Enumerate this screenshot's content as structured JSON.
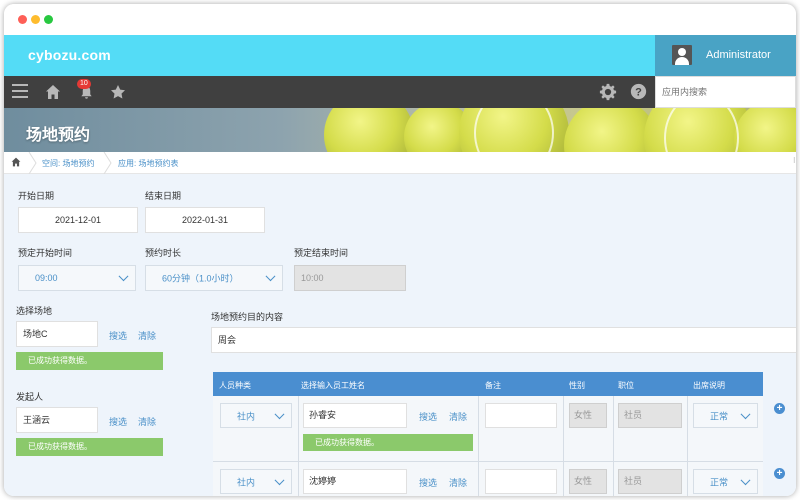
{
  "header": {
    "logo": "cybozu.com",
    "user": "Administrator"
  },
  "nav": {
    "notification_count": "10",
    "search_placeholder": "应用内搜索"
  },
  "banner": {
    "title": "场地预约"
  },
  "breadcrumb": {
    "space": "空间: 场地预约",
    "app": "应用: 场地预约表"
  },
  "form": {
    "start_date": {
      "label": "开始日期",
      "value": "2021-12-01"
    },
    "end_date": {
      "label": "结束日期",
      "value": "2022-01-31"
    },
    "start_time": {
      "label": "预定开始时间",
      "value": "09:00"
    },
    "duration": {
      "label": "预约时长",
      "value": "60分钟（1.0小时）"
    },
    "end_time": {
      "label": "预定结束时间",
      "value": "10:00"
    },
    "venue": {
      "label": "选择场地",
      "value": "场地C",
      "lookup": "搜选",
      "clear": "清除",
      "status": "已成功获得数据。"
    },
    "purpose": {
      "label": "场地预约目的内容",
      "value": "周会"
    },
    "organizer": {
      "label": "发起人",
      "value": "王涵云",
      "lookup": "搜选",
      "clear": "清除",
      "status": "已成功获得数据。"
    }
  },
  "table": {
    "headers": [
      "人员种类",
      "选择输入员工姓名",
      "备注",
      "性别",
      "职位",
      "出席说明"
    ],
    "rows": [
      {
        "type": "社内",
        "name": "孙睿安",
        "lookup": "搜选",
        "clear": "清除",
        "note": "",
        "gender": "女性",
        "position": "社员",
        "attendance": "正常",
        "status": "已成功获得数据。"
      },
      {
        "type": "社内",
        "name": "沈婷婷",
        "lookup": "搜选",
        "clear": "清除",
        "note": "",
        "gender": "女性",
        "position": "社员",
        "attendance": "正常"
      }
    ]
  },
  "add_row_symbol": "+",
  "colors": {
    "topbar": "#54dcf6",
    "user_area": "#49a3c5",
    "navbar": "#404040",
    "table_header": "#4a8ed0",
    "success": "#8bc96b",
    "link": "#4a90c8"
  }
}
